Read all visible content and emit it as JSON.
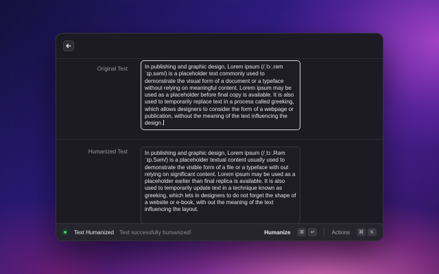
{
  "header": {
    "back_icon": "arrow-left-icon"
  },
  "original": {
    "label": "Original Text",
    "text": "In publishing and graphic design, Lorem ipsum (/ˌlɔː.rəm ˈɪp.səm/) is a placeholder text commonly used to demonstrate the visual form of a document or a typeface without relying on meaningful content. Lorem ipsum may be used as a placeholder before final copy is available. It is also used to temporarily replace text in a process called greeking, which allows designers to consider the form of a webpage or publication, without the meaning of the text influencing the design."
  },
  "humanized": {
    "label": "Humanized Text",
    "text": "In publishing and graphic design, Lorem ipsum (/ˌlɔː.Rəm ˈɪp.Səm/) is a placeholder textual content usually used to demonstrate the visible form of a file or a typeface with out relying on significant content. Lorem ipsum may be used as a placeholder earlier than final replica is available. It is also used to temporarily update text in a technique known as greeking, which lets in designers to do not forget the shape of a website or e-book, with out the meaning of the text influencing the layout."
  },
  "footer": {
    "status_title": "Text Humanized",
    "status_message": "Text successfully humanized!",
    "primary_action": "Humanize",
    "primary_shortcut": [
      "⌘",
      "↵"
    ],
    "actions_label": "Actions",
    "actions_shortcut": [
      "⌘",
      "K"
    ]
  },
  "colors": {
    "status_green": "#3fd27a",
    "window_bg": "#1c1a22"
  }
}
